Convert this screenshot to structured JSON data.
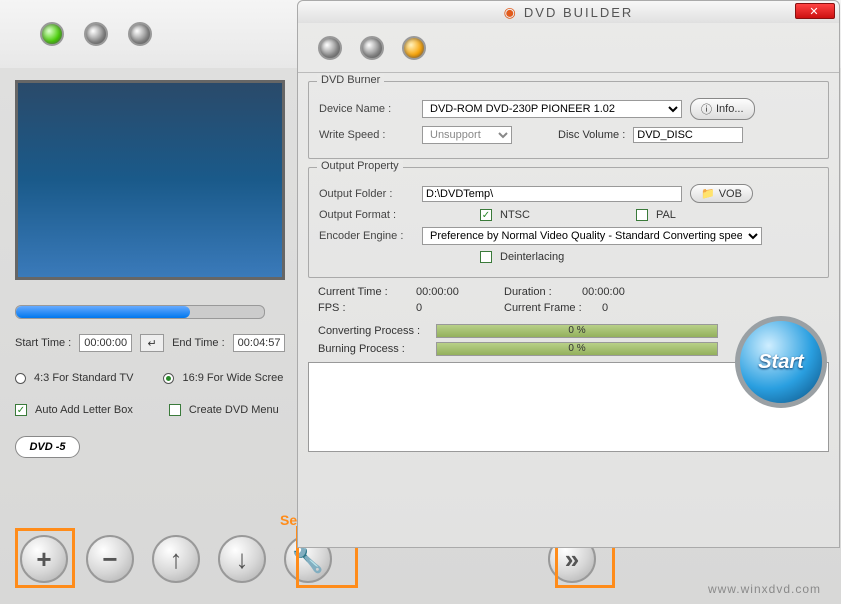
{
  "app": {
    "title": "DVD BUILDER",
    "footer_brand": "www.winxdvd.com"
  },
  "annotations": {
    "setting": "Setting Button"
  },
  "trim": {
    "start_label": "Start Time :",
    "start_value": "00:00:00",
    "end_label": "End Time :",
    "end_value": "00:04:57"
  },
  "aspect": {
    "std_label": "4:3 For Standard TV",
    "wide_label": "16:9 For Wide Scree"
  },
  "options": {
    "letterbox_label": "Auto Add Letter Box",
    "menu_label": "Create DVD Menu",
    "dvd_type": "DVD -5"
  },
  "burner": {
    "group_title": "DVD Burner",
    "device_label": "Device Name :",
    "device_value": "DVD-ROM DVD-230P PIONEER  1.02",
    "info_label": "Info...",
    "speed_label": "Write Speed :",
    "speed_value": "Unsupport",
    "volume_label": "Disc Volume :",
    "volume_value": "DVD_DISC"
  },
  "output": {
    "group_title": "Output Property",
    "folder_label": "Output Folder :",
    "folder_value": "D:\\DVDTemp\\",
    "vob_label": "VOB",
    "format_label": "Output Format :",
    "ntsc_label": "NTSC",
    "pal_label": "PAL",
    "engine_label": "Encoder Engine :",
    "engine_value": "Preference by Normal Video Quality - Standard Converting speed",
    "deint_label": "Deinterlacing"
  },
  "progress": {
    "ct_label": "Current Time :",
    "ct_value": "00:00:00",
    "dur_label": "Duration :",
    "dur_value": "00:00:00",
    "fps_label": "FPS :",
    "fps_value": "0",
    "frame_label": "Current Frame :",
    "frame_value": "0",
    "conv_label": "Converting Process :",
    "conv_value": "0 %",
    "burn_label": "Burning Process :",
    "burn_value": "0 %",
    "start_label": "Start"
  }
}
